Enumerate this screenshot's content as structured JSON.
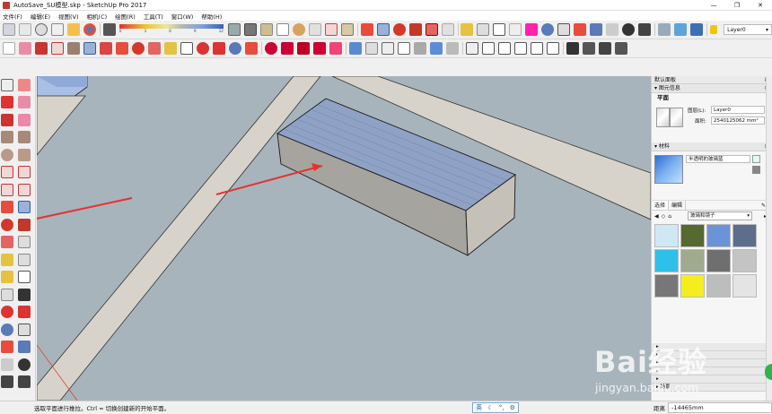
{
  "window": {
    "title": "AutoSave_SU模型.skp - SketchUp Pro 2017"
  },
  "menu": [
    "文件(F)",
    "编辑(E)",
    "视图(V)",
    "相机(C)",
    "绘图(R)",
    "工具(T)",
    "窗口(W)",
    "帮助(H)"
  ],
  "toolbar": {
    "layer_dropdown": "Layer0",
    "legend_numbers": [
      "0",
      "1",
      "2",
      "3",
      "4",
      "5",
      "6",
      "7",
      "8",
      "9",
      "10",
      "11",
      "12"
    ]
  },
  "tray": {
    "title": "默认面板",
    "entity_info_header": "图元信息",
    "entity_type": "平面",
    "layer_label": "图层(L):",
    "layer_value": "Layer0",
    "area_label": "面积:",
    "area_value": "2540125062 mm²",
    "materials_header": "材料",
    "material_name": "半透明的玻璃蓝",
    "tab_select": "选择",
    "tab_edit": "编辑",
    "library_value": "玻璃和镜子"
  },
  "status": {
    "tip": "选取平面进行推拉。Ctrl = 切换创建新的开始平面。",
    "distance_label": "距离",
    "distance_value": "-14465mm",
    "bottom_row_label": "场景"
  },
  "watermark": {
    "brand": "Bai经验",
    "url": "jingyan.baidu.com"
  },
  "colors": {
    "viewport_bg": "#a7b4bb",
    "selected_face": "#8fa2c6",
    "road": "#d7d3cb",
    "arrow": "#e6322f"
  }
}
